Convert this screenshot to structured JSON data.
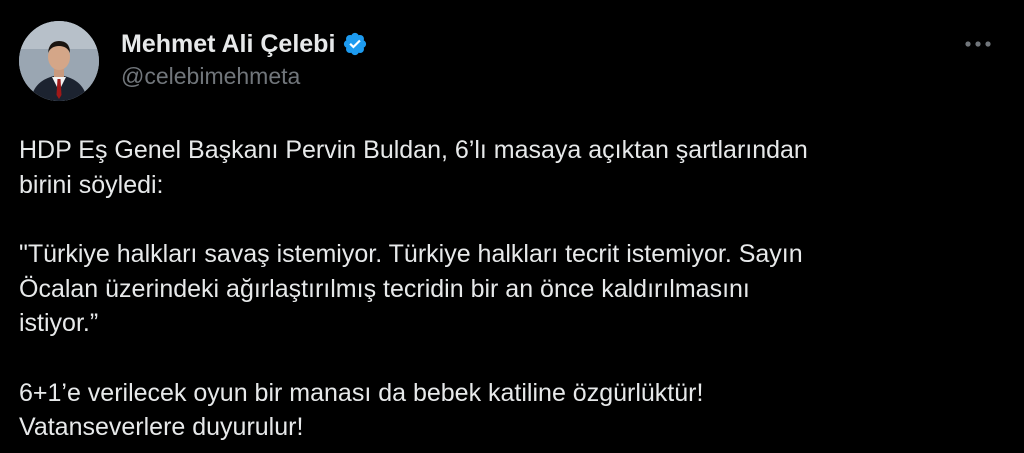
{
  "tweet": {
    "author": {
      "display_name": "Mehmet Ali Çelebi",
      "handle": "@celebimehmeta",
      "verified": true,
      "avatar_icon": "profile-photo-avatar"
    },
    "more_icon": "more-options-icon",
    "paragraphs": [
      "HDP Eş Genel Başkanı Pervin Buldan, 6’lı masaya açıktan şartlarından\nbirini söyledi:",
      "\"Türkiye halkları savaş istemiyor. Türkiye halkları tecrit istemiyor. Sayın\nÖcalan üzerindeki ağırlaştırılmış tecridin bir an önce kaldırılmasını\nistiyor.”",
      "6+1’e verilecek oyun bir manası da bebek katiline özgürlüktür!\nVatanseverlere duyurulur!"
    ]
  },
  "colors": {
    "background": "#000000",
    "primary_text": "#e7e9ea",
    "secondary_text": "#71767b",
    "verified_badge": "#1d9bf0"
  }
}
